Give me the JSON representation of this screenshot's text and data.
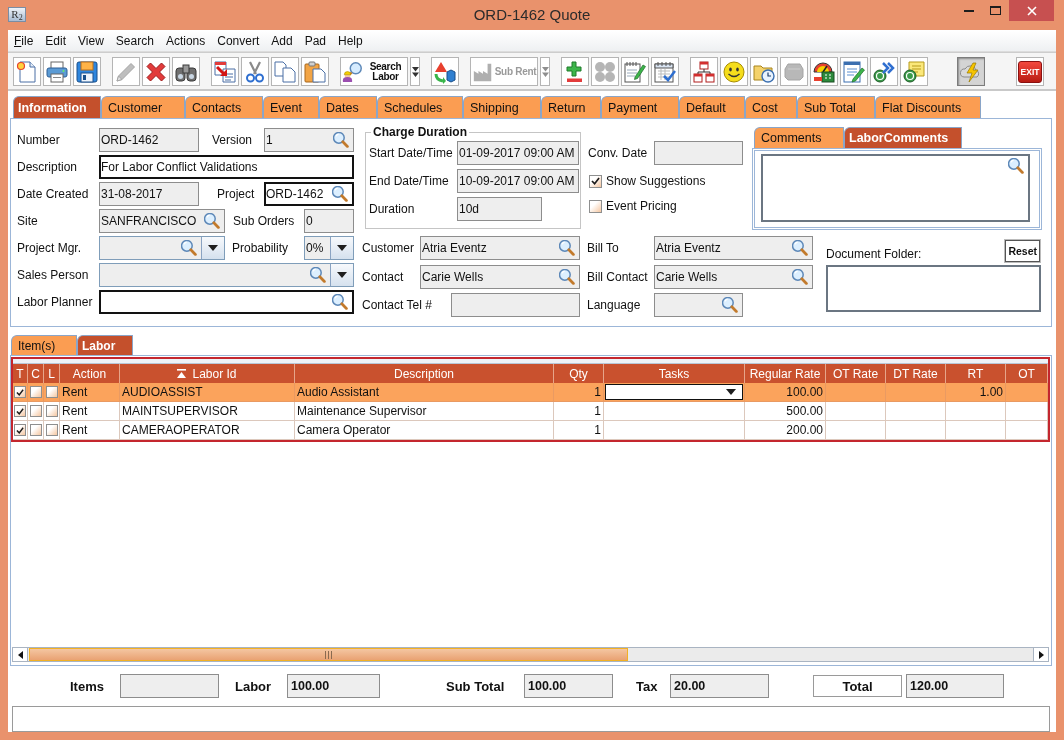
{
  "window": {
    "title": "ORD-1462 Quote",
    "logo": "R$_{2}$"
  },
  "menu_bar": [
    {
      "label": "File",
      "mnemonic": true
    },
    {
      "label": "Edit",
      "mnemonic": false
    },
    {
      "label": "View",
      "mnemonic": false
    },
    {
      "label": "Search",
      "mnemonic": false
    },
    {
      "label": "Actions",
      "mnemonic": false
    },
    {
      "label": "Convert",
      "mnemonic": false
    },
    {
      "label": "Add",
      "mnemonic": false
    },
    {
      "label": "Pad",
      "mnemonic": false
    },
    {
      "label": "Help",
      "mnemonic": false
    }
  ],
  "toolbar": [
    [
      {
        "kind": "icon",
        "disabled": false,
        "pressed": false
      },
      {
        "kind": "icon",
        "disabled": false,
        "pressed": false
      },
      {
        "kind": "icon",
        "disabled": false,
        "pressed": false
      }
    ],
    [
      {
        "kind": "icon",
        "disabled": true,
        "pressed": false
      },
      {
        "kind": "icon",
        "disabled": false,
        "pressed": false
      },
      {
        "kind": "icon",
        "disabled": false,
        "pressed": false
      }
    ],
    [
      {
        "kind": "icon",
        "disabled": false,
        "pressed": false
      },
      {
        "kind": "icon",
        "disabled": false,
        "pressed": false
      },
      {
        "kind": "icon",
        "disabled": false,
        "pressed": false
      },
      {
        "kind": "icon",
        "disabled": false,
        "pressed": false
      }
    ],
    [
      {
        "kind": "labeled",
        "label": "Search Labor",
        "disabled": false,
        "pressed": false
      },
      {
        "kind": "menu_arrow",
        "disabled": false,
        "pressed": false
      }
    ],
    [
      {
        "kind": "icon",
        "disabled": false,
        "pressed": false
      }
    ],
    [
      {
        "kind": "labeled",
        "label": "Sub Rent",
        "disabled": true,
        "pressed": false
      },
      {
        "kind": "menu_arrow",
        "disabled": true,
        "pressed": false
      }
    ],
    [
      {
        "kind": "icon",
        "disabled": false,
        "pressed": false
      },
      {
        "kind": "icon",
        "disabled": true,
        "pressed": false
      },
      {
        "kind": "icon",
        "disabled": false,
        "pressed": false
      },
      {
        "kind": "icon",
        "disabled": false,
        "pressed": false
      }
    ],
    [
      {
        "kind": "icon",
        "disabled": false,
        "pressed": false
      },
      {
        "kind": "icon",
        "disabled": false,
        "pressed": false
      },
      {
        "kind": "icon",
        "disabled": false,
        "pressed": false
      },
      {
        "kind": "icon",
        "disabled": true,
        "pressed": false
      },
      {
        "kind": "icon",
        "disabled": false,
        "pressed": false
      },
      {
        "kind": "icon",
        "disabled": false,
        "pressed": false
      },
      {
        "kind": "icon",
        "disabled": false,
        "pressed": false
      },
      {
        "kind": "icon",
        "disabled": false,
        "pressed": false
      }
    ],
    [
      {
        "kind": "icon",
        "disabled": false,
        "pressed": true
      }
    ],
    [
      {
        "kind": "exit",
        "label": "EXIT",
        "disabled": false,
        "pressed": false
      }
    ]
  ],
  "tabs": [
    {
      "label": "Information",
      "selected": true
    },
    {
      "label": "Customer",
      "selected": false
    },
    {
      "label": "Contacts",
      "selected": false
    },
    {
      "label": "Event",
      "selected": false
    },
    {
      "label": "Dates",
      "selected": false
    },
    {
      "label": "Schedules",
      "selected": false
    },
    {
      "label": "Shipping",
      "selected": false
    },
    {
      "label": "Return",
      "selected": false
    },
    {
      "label": "Payment",
      "selected": false
    },
    {
      "label": "Default",
      "selected": false
    },
    {
      "label": "Cost",
      "selected": false
    },
    {
      "label": "Sub Total",
      "selected": false
    },
    {
      "label": "Flat Discounts",
      "selected": false
    }
  ],
  "information": {
    "fields": [
      [
        {
          "label": "Number",
          "value": "ORD-1462",
          "kind": "text",
          "editable": false
        },
        {
          "label": "Version",
          "value": "1",
          "kind": "lookup",
          "editable": false
        }
      ],
      [
        {
          "label": "Description",
          "value": "For Labor Conflict Validations",
          "kind": "text",
          "editable": true
        }
      ],
      [
        {
          "label": "Date Created",
          "value": "31-08-2017",
          "kind": "text",
          "editable": false
        },
        {
          "label": "Project",
          "value": "ORD-1462",
          "kind": "lookup",
          "editable": true
        }
      ],
      [
        {
          "label": "Site",
          "value": "SANFRANCISCO",
          "kind": "lookup",
          "editable": false
        },
        {
          "label": "Sub Orders",
          "value": "0",
          "kind": "text",
          "editable": false
        }
      ],
      [
        {
          "label": "Project Mgr.",
          "kind": "lookup_combo",
          "editable": false
        },
        {
          "label": "Probability",
          "value": "0%",
          "kind": "combo",
          "editable": false
        }
      ],
      [
        {
          "label": "Sales Person",
          "kind": "lookup_combo",
          "editable": false
        }
      ],
      [
        {
          "label": "Labor Planner",
          "kind": "lookup",
          "editable": true
        }
      ]
    ],
    "charge_duration": {
      "title": "Charge Duration",
      "fields": [
        {
          "label": "Start Date/Time",
          "value": "01-09-2017 09:00 AM",
          "kind": "text",
          "editable": false
        },
        {
          "label": "End Date/Time",
          "value": "10-09-2017 09:00 AM",
          "kind": "text",
          "editable": false
        },
        {
          "label": "Duration",
          "value": "10d",
          "kind": "text",
          "editable": false
        }
      ]
    },
    "conv_date": {
      "label": "Conv. Date",
      "kind": "text",
      "editable": false
    },
    "checkboxes": [
      {
        "label": "Show Suggestions",
        "checked": true
      },
      {
        "label": "Event Pricing",
        "checked": false
      }
    ],
    "comment_tabs": [
      {
        "label": "Comments",
        "selected": false
      },
      {
        "label": "LaborComments",
        "selected": true
      }
    ],
    "party_fields": [
      [
        {
          "label": "Customer",
          "value": "Atria Eventz",
          "kind": "lookup",
          "editable": false
        },
        {
          "label": "Bill To",
          "value": "Atria Eventz",
          "kind": "lookup",
          "editable": false
        }
      ],
      [
        {
          "label": "Contact",
          "value": "Carie Wells",
          "kind": "lookup",
          "editable": false
        },
        {
          "label": "Bill Contact",
          "value": "Carie Wells",
          "kind": "lookup",
          "editable": false
        }
      ],
      [
        {
          "label": "Contact Tel #",
          "kind": "text",
          "editable": false
        },
        {
          "label": "Language",
          "kind": "lookup",
          "editable": false
        }
      ]
    ],
    "document_folder": {
      "label": "Document Folder:",
      "button": "Reset"
    }
  },
  "sub_tabs": [
    {
      "label": "Item(s)",
      "selected": false
    },
    {
      "label": "Labor",
      "selected": true
    }
  ],
  "labor_table": {
    "columns": [
      {
        "label": "T",
        "sorted": false
      },
      {
        "label": "C",
        "sorted": false
      },
      {
        "label": "L",
        "sorted": false
      },
      {
        "label": "Action",
        "sorted": false
      },
      {
        "label": "Labor Id",
        "sorted": true
      },
      {
        "label": "Description",
        "sorted": false
      },
      {
        "label": "Qty",
        "sorted": false
      },
      {
        "label": "Tasks",
        "sorted": false
      },
      {
        "label": "Regular Rate",
        "sorted": false
      },
      {
        "label": "OT Rate",
        "sorted": false
      },
      {
        "label": "DT Rate",
        "sorted": false
      },
      {
        "label": "RT",
        "sorted": false
      },
      {
        "label": "OT",
        "sorted": false
      }
    ],
    "rows": [
      {
        "selected": true,
        "editing": true,
        "checks": [
          {
            "checked": true
          },
          {
            "checked": false
          },
          {
            "checked": false
          }
        ],
        "cells": {
          "action": "Rent",
          "labor_id": "AUDIOASSIST",
          "description": "Audio Assistant",
          "qty": "1",
          "regular_rate": "100.00",
          "rt": "1.00"
        }
      },
      {
        "selected": false,
        "editing": false,
        "checks": [
          {
            "checked": true
          },
          {
            "checked": false
          },
          {
            "checked": false
          }
        ],
        "cells": {
          "action": "Rent",
          "labor_id": "MAINTSUPERVISOR",
          "description": "Maintenance Supervisor",
          "qty": "1",
          "regular_rate": "500.00"
        }
      },
      {
        "selected": false,
        "editing": false,
        "checks": [
          {
            "checked": true
          },
          {
            "checked": false
          },
          {
            "checked": false
          }
        ],
        "cells": {
          "action": "Rent",
          "labor_id": "CAMERAOPERATOR",
          "description": "Camera Operator",
          "qty": "1",
          "regular_rate": "200.00"
        }
      }
    ]
  },
  "totals": [
    {
      "kind": "sum",
      "label": "Items"
    },
    {
      "kind": "sum",
      "label": "Labor",
      "value": "100.00"
    },
    {
      "kind": "sum",
      "label": "Sub Total",
      "value": "100.00"
    },
    {
      "kind": "sum",
      "label": "Tax",
      "value": "20.00"
    },
    {
      "kind": "grand_total",
      "label": "Total",
      "value": "120.00"
    }
  ]
}
